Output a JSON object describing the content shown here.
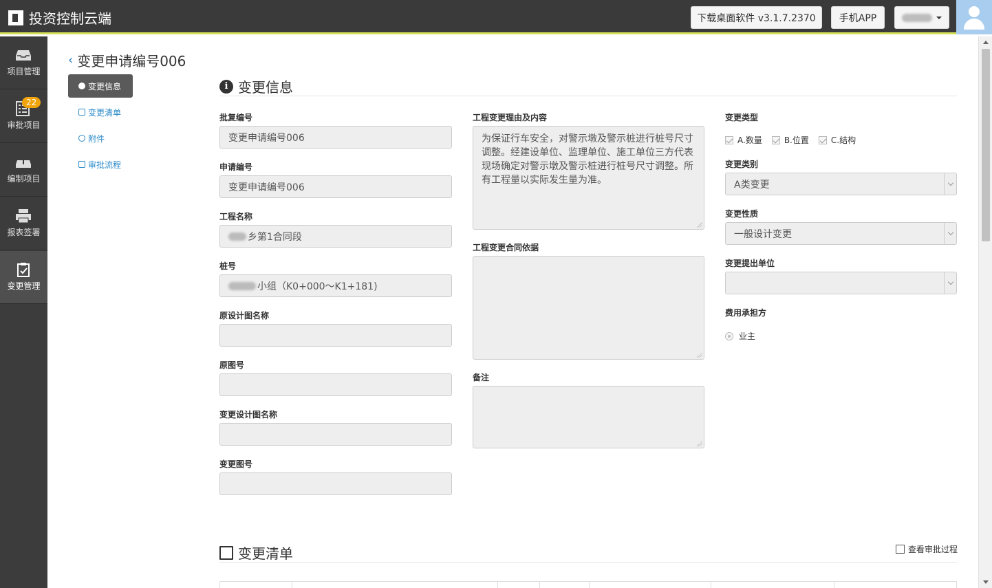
{
  "app": {
    "title": "投资控制云端"
  },
  "topbar": {
    "download_label": "下载桌面软件 v3.1.7.2370",
    "app_label": "手机APP"
  },
  "sidenav": {
    "items": [
      {
        "label": "项目管理",
        "icon": "inbox-icon"
      },
      {
        "label": "审批项目",
        "icon": "checklist-icon",
        "badge": "22"
      },
      {
        "label": "编制项目",
        "icon": "upload-tray-icon"
      },
      {
        "label": "报表签署",
        "icon": "printer-icon"
      },
      {
        "label": "变更管理",
        "icon": "clipboard-check-icon",
        "active": true
      }
    ]
  },
  "page": {
    "title": "变更申请编号006"
  },
  "subnav": {
    "items": [
      {
        "label": "变更信息",
        "active": true
      },
      {
        "label": "变更清单"
      },
      {
        "label": "附件"
      },
      {
        "label": "审批流程"
      }
    ]
  },
  "section_info": {
    "title": "变更信息"
  },
  "form": {
    "approval_no": {
      "label": "批复编号",
      "value": "变更申请编号006"
    },
    "application_no": {
      "label": "申请编号",
      "value": "变更申请编号006"
    },
    "project_name": {
      "label": "工程名称",
      "value": "乡第1合同段"
    },
    "stake_no": {
      "label": "桩号",
      "value": "小组（K0+000～K1+181)"
    },
    "orig_drawing_name": {
      "label": "原设计图名称",
      "value": ""
    },
    "orig_drawing_no": {
      "label": "原图号",
      "value": ""
    },
    "change_drawing_name": {
      "label": "变更设计图名称",
      "value": ""
    },
    "change_drawing_no": {
      "label": "变更图号",
      "value": ""
    },
    "reason": {
      "label": "工程变更理由及内容",
      "value": "为保证行车安全，对警示墩及警示桩进行桩号尺寸调整。经建设单位、监理单位、施工单位三方代表现场确定对警示墩及警示桩进行桩号尺寸调整。所有工程量以实际发生量为准。"
    },
    "contract_basis": {
      "label": "工程变更合同依据",
      "value": ""
    },
    "remark": {
      "label": "备注",
      "value": ""
    },
    "change_type": {
      "label": "变更类型",
      "options": [
        "A.数量",
        "B.位置",
        "C.结构"
      ]
    },
    "change_category": {
      "label": "变更类别",
      "value": "A类变更"
    },
    "change_nature": {
      "label": "变更性质",
      "value": "一般设计变更"
    },
    "proposer": {
      "label": "变更提出单位",
      "value": ""
    },
    "cost_bearer": {
      "label": "费用承担方",
      "value": "业主"
    }
  },
  "section_list": {
    "title": "变更清单",
    "view_process_label": "查看审批过程"
  }
}
